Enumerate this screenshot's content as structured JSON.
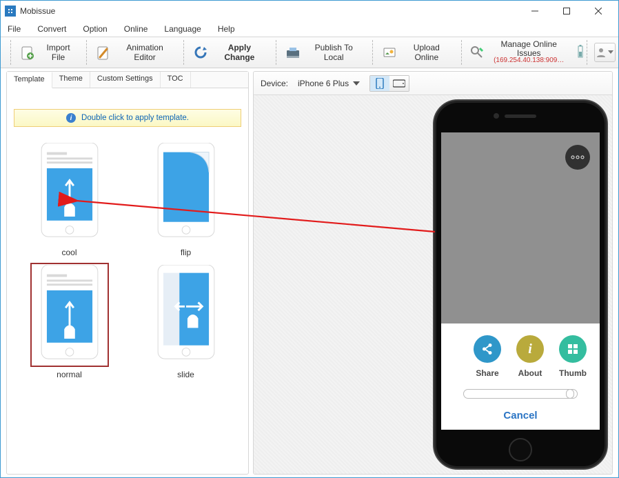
{
  "window": {
    "title": "Mobissue"
  },
  "menu": [
    "File",
    "Convert",
    "Option",
    "Online",
    "Language",
    "Help"
  ],
  "toolbar": {
    "import": "Import File",
    "animation": "Animation Editor",
    "apply": "Apply Change",
    "publish": "Publish To Local",
    "upload": "Upload Online",
    "manage": "Manage Online Issues",
    "ip": "(169.254.40.138:909…"
  },
  "left_tabs": [
    "Template",
    "Theme",
    "Custom Settings",
    "TOC"
  ],
  "active_left_tab": 0,
  "hint": "Double click to apply template.",
  "templates": [
    {
      "name": "cool"
    },
    {
      "name": "flip"
    },
    {
      "name": "normal"
    },
    {
      "name": "slide"
    }
  ],
  "selected_template": 2,
  "device": {
    "label": "Device:",
    "model": "iPhone 6 Plus"
  },
  "phone": {
    "more_label": "○○○",
    "sheet": {
      "share": "Share",
      "about": "About",
      "thumb": "Thumb",
      "cancel": "Cancel"
    }
  }
}
